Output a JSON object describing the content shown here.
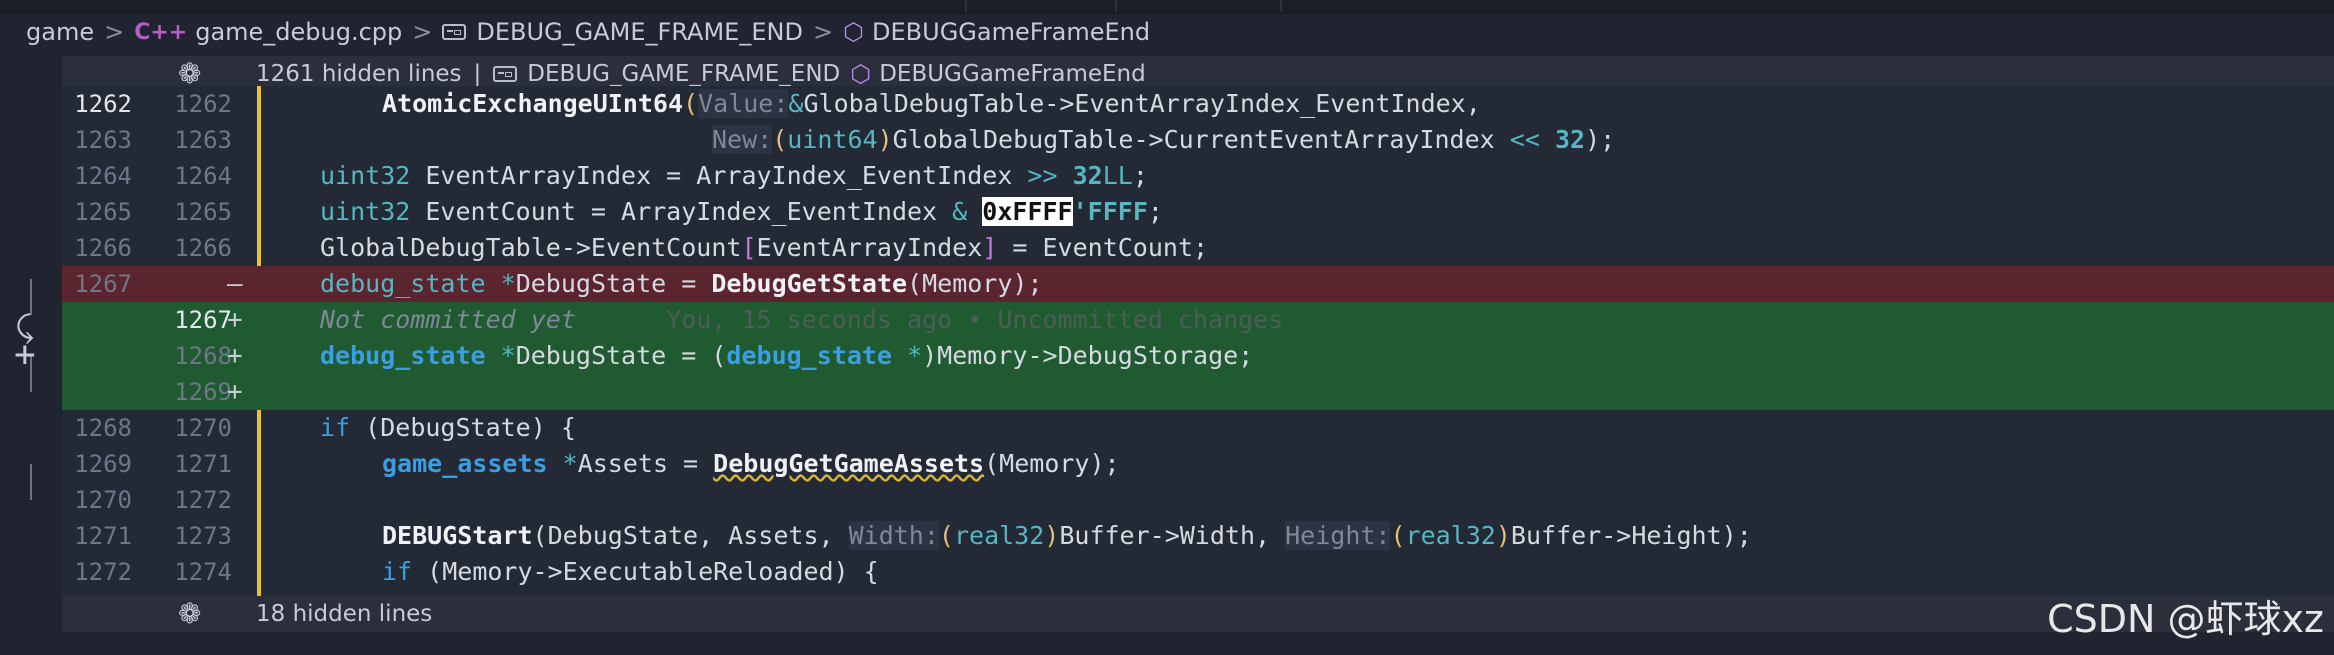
{
  "breadcrumb": {
    "root": "game",
    "file_icon": "C++",
    "file": "game_debug.cpp",
    "macro": "DEBUG_GAME_FRAME_END",
    "symbol": "DEBUGGameFrameEnd"
  },
  "fold_top": {
    "text": "1261 hidden lines",
    "divider": "|",
    "macro": "DEBUG_GAME_FRAME_END",
    "symbol": "DEBUGGameFrameEnd"
  },
  "fold_bottom": {
    "text": "18 hidden lines"
  },
  "lines": {
    "l0": {
      "old": "1262",
      "new": "1262"
    },
    "l1": {
      "old": "1263",
      "new": "1263"
    },
    "l2": {
      "old": "1264",
      "new": "1264"
    },
    "l3": {
      "old": "1265",
      "new": "1265"
    },
    "l4": {
      "old": "1266",
      "new": "1266"
    },
    "l5": {
      "old": "1267",
      "new": "",
      "marker": "—"
    },
    "l6": {
      "old": "",
      "new": "1267",
      "marker": "+"
    },
    "l7": {
      "old": "",
      "new": "1268",
      "marker": "+"
    },
    "l8": {
      "old": "",
      "new": "1269",
      "marker": "+"
    },
    "l9": {
      "old": "1268",
      "new": "1270"
    },
    "l10": {
      "old": "1269",
      "new": "1271"
    },
    "l11": {
      "old": "1270",
      "new": "1272"
    },
    "l12": {
      "old": "1271",
      "new": "1273"
    },
    "l13": {
      "old": "1272",
      "new": "1274"
    }
  },
  "code": {
    "t0_fn": "AtomicExchangeUInt64",
    "t0_hint": "Value:",
    "t0_amp": "&",
    "t0_rest": "GlobalDebugTable->EventArrayIndex_EventIndex,",
    "t1_hint": "New:",
    "t1_type": "uint64",
    "t1_rest": "GlobalDebugTable->CurrentEventArrayIndex",
    "t1_op": "<<",
    "t1_num": "32",
    "t1_end": ");",
    "t2_type": "uint32",
    "t2_mid": " EventArrayIndex = ArrayIndex_EventIndex ",
    "t2_op": ">>",
    "t2_num": "32",
    "t2_suf": "LL",
    "t2_end": ";",
    "t3_type": "uint32",
    "t3_mid": " EventCount = ArrayIndex_EventIndex ",
    "t3_op": "&",
    "t3_hex_a": "0xFFFF",
    "t3_hex_b": "'FFFF",
    "t3_end": ";",
    "t4_a": "GlobalDebugTable->EventCount",
    "t4_b": "EventArrayIndex",
    "t4_c": " = EventCount;",
    "t5_type": "debug_state",
    "t5_ptr": "*",
    "t5_var": "DebugState = ",
    "t5_fn": "DebugGetState",
    "t5_args": "(Memory);",
    "t6_note": "Not committed yet",
    "t6_blame": "You, 15 seconds ago • Uncommitted changes",
    "t7_type": "debug_state",
    "t7_ptr": "*",
    "t7_var": "DebugState = (",
    "t7_type2": "debug_state",
    "t7_ptr2": " *",
    "t7_rest": ")Memory->DebugStorage;",
    "t9_kw": "if",
    "t9_rest": " (DebugState) {",
    "t10_type": "game_assets",
    "t10_ptr": "*",
    "t10_var": "Assets = ",
    "t10_fn": "DebugGetGameAssets",
    "t10_args": "(Memory);",
    "t12_fn": "DEBUGStart",
    "t12_a": "(DebugState, Assets, ",
    "t12_h1": "Width:",
    "t12_c1": "real32",
    "t12_b": "Buffer->Width, ",
    "t12_h2": "Height:",
    "t12_c2": "real32",
    "t12_c": "Buffer->Height);",
    "t13_kw": "if",
    "t13_rest": " (Memory->ExecutableReloaded) {"
  },
  "watermark": "CSDN @虾球xz"
}
